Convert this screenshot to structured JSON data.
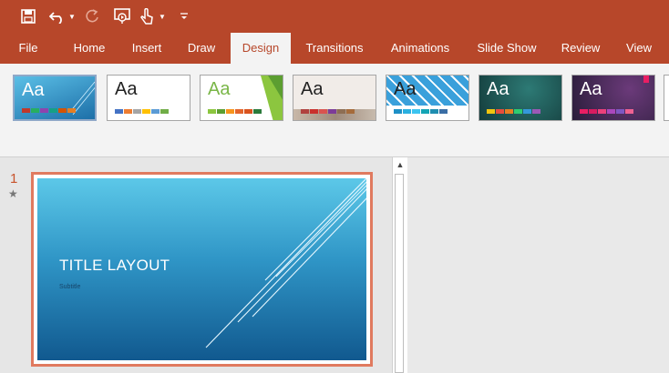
{
  "colors": {
    "accent": "#b7472a",
    "ribbon_bg": "#f3f3f3",
    "selection": "#e07a5f"
  },
  "qat": {
    "icons": [
      "save-icon",
      "undo-icon",
      "undo-dropdown-icon",
      "redo-icon",
      "present-from-start-icon",
      "touch-mode-icon",
      "touch-dropdown-icon",
      "customize-qat-icon"
    ]
  },
  "tabs": [
    {
      "label": "File"
    },
    {
      "label": "Home"
    },
    {
      "label": "Insert"
    },
    {
      "label": "Draw"
    },
    {
      "label": "Design",
      "active": true
    },
    {
      "label": "Transitions"
    },
    {
      "label": "Animations"
    },
    {
      "label": "Slide Show"
    },
    {
      "label": "Review"
    },
    {
      "label": "View"
    }
  ],
  "themes": [
    {
      "label": "Aa",
      "bg": "#2e8fc5",
      "text": "#ffffff",
      "bars": [
        "#c0392b",
        "#27ae60",
        "#8e44ad",
        "#16a085",
        "#d35400",
        "#e67e22"
      ]
    },
    {
      "label": "Aa",
      "bg": "#ffffff",
      "text": "#222222",
      "bars": [
        "#4472c4",
        "#ed7d31",
        "#a5a5a5",
        "#ffc000",
        "#5b9bd5",
        "#70ad47"
      ]
    },
    {
      "label": "Aa",
      "bg": "#ffffff",
      "text": "#7ab648",
      "bars": [
        "#8cc63f",
        "#5c9e31",
        "#f7941d",
        "#e3642b",
        "#d9531e",
        "#2b7a3b"
      ]
    },
    {
      "label": "Aa",
      "bg": "#f2eeea",
      "text": "#222222",
      "bars": [
        "#b0413e",
        "#c9302c",
        "#d9534f",
        "#7d3c98",
        "#8e6e53",
        "#a56b3b"
      ]
    },
    {
      "label": "Aa",
      "bg": "#3a9ad9",
      "text": "#222222",
      "bars": [
        "#1e90c6",
        "#2bb0e0",
        "#3cc4f0",
        "#14a5b5",
        "#1f8eb0",
        "#3a6ea5"
      ]
    },
    {
      "label": "Aa",
      "bg": "#1e4f4f",
      "text": "#ffffff",
      "bars": [
        "#f1c40f",
        "#e74c3c",
        "#e67e22",
        "#2ecc71",
        "#3498db",
        "#9b59b6"
      ]
    },
    {
      "label": "Aa",
      "bg": "#3b2b4f",
      "text": "#ffffff",
      "bars": [
        "#e91e63",
        "#d81b60",
        "#ec407a",
        "#ab47bc",
        "#7e57c2",
        "#f06292"
      ]
    }
  ],
  "thumbnail": {
    "number": "1",
    "title": "TITLE LAYOUT",
    "subtitle": "Subtitle"
  },
  "scrollbar": {
    "up_icon": "chevron-up-icon"
  }
}
